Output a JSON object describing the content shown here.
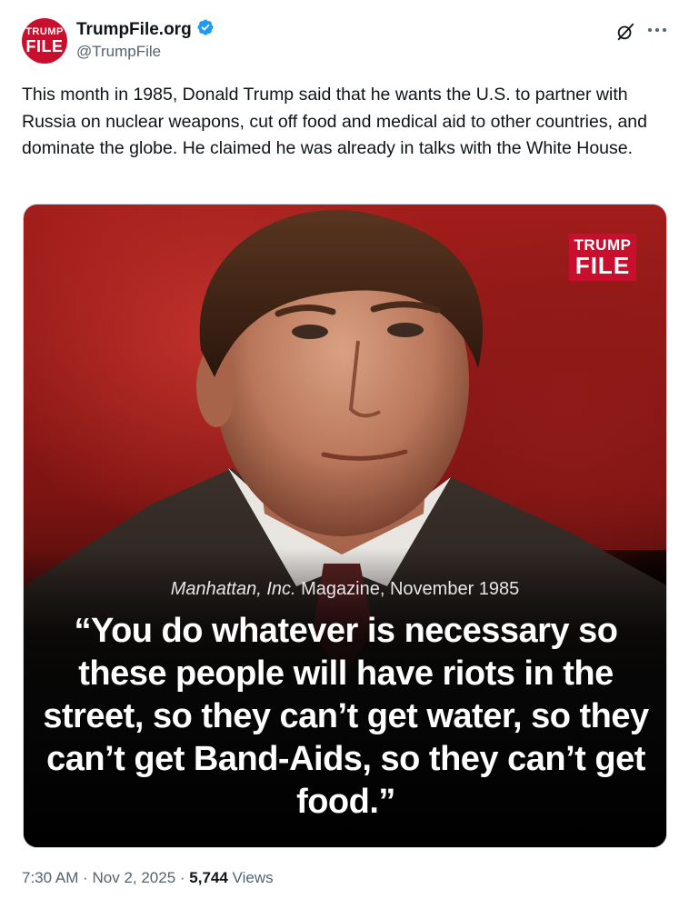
{
  "author": {
    "display_name": "TrumpFile.org",
    "handle": "@TrumpFile",
    "avatar_line1": "TRUMP",
    "avatar_line2": "FILE",
    "verified_color": "#1d9bf0"
  },
  "tweet": {
    "text": "This month in 1985, Donald Trump said that he wants the U.S. to partner with Russia on nuclear weapons, cut off food and medical aid to other countries, and dominate the globe. He claimed he was already in talks with the White House."
  },
  "media": {
    "logo_line1": "TRUMP",
    "logo_line2": "FILE",
    "source_magazine": "Manhattan, Inc.",
    "source_rest": " Magazine, November 1985",
    "quote": "“You do whatever is necessary so these people will have riots in the street, so they can’t get water, so they can’t get Band-Aids, so they can’t get food.”",
    "brand_color": "#c8102e"
  },
  "meta": {
    "time": "7:30 AM",
    "separator1": " · ",
    "date": "Nov 2, 2025",
    "separator2": " · ",
    "views_count": "5,744",
    "views_label": " Views"
  },
  "icons": [
    "verified-badge-icon",
    "grok-icon",
    "more-icon"
  ]
}
